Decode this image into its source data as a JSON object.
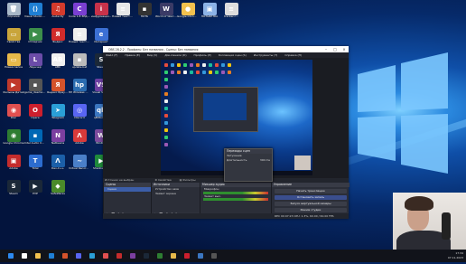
{
  "desktop_icons": [
    {
      "label": "Корзина",
      "color": "#a9b8c8",
      "glyph": "🗑"
    },
    {
      "label": "Visual Studio Code",
      "color": "#1f7fd4",
      "glyph": "⟨⟩"
    },
    {
      "label": "Audacity",
      "color": "#d33a2c",
      "glyph": "♫"
    },
    {
      "label": "Code 1.8 ЗРД код",
      "color": "#7a3fd1",
      "glyph": "C"
    },
    {
      "label": "инфурмацио..",
      "color": "#c8324a",
      "glyph": "i"
    },
    {
      "label": "Новый текстовый...",
      "color": "#e6e6e6",
      "glyph": "≡"
    },
    {
      "label": "ПОТЬ",
      "color": "#333",
      "glyph": "▪"
    },
    {
      "label": "World of Warcraft",
      "color": "#3b3b66",
      "glyph": "W"
    },
    {
      "label": "Google Chrome Beta",
      "color": "#f2c14e",
      "glyph": "●"
    },
    {
      "label": "ПОТЬВЕТКА",
      "color": "#8cb3e6",
      "glyph": "▣"
    },
    {
      "label": "tracker.c...",
      "color": "#ddd",
      "glyph": "≡"
    },
    {
      "label": "Свойства",
      "color": "#c9a53b",
      "glyph": "▭"
    },
    {
      "label": "Отладчик",
      "color": "#3c8e4a",
      "glyph": "▶"
    },
    {
      "label": "Яндекс",
      "color": "#d12b2b",
      "glyph": "Я"
    },
    {
      "label": "Новый текстовый",
      "color": "#eee",
      "glyph": "≡"
    },
    {
      "label": "Интернет",
      "color": "#3b6fd4",
      "glyph": "e"
    },
    {
      "label": "Новая папка",
      "color": "#e8b94a",
      "glyph": "▭"
    },
    {
      "label": "Лаунчер",
      "color": "#6b4ca8",
      "glyph": "L"
    },
    {
      "label": "ABC",
      "color": "#f0f0f0",
      "glyph": "AB"
    },
    {
      "label": "update.bat",
      "color": "#bbb",
      "glyph": "▪"
    },
    {
      "label": "Steam",
      "color": "#1b2838",
      "glyph": "S"
    },
    {
      "label": "Фильмы Детей",
      "color": "#c0392b",
      "glyph": "▶"
    },
    {
      "label": "game_daemon.exe",
      "color": "#555",
      "glyph": "▪"
    },
    {
      "label": "Яндекс Браузер",
      "color": "#d4532b",
      "glyph": "Я"
    },
    {
      "label": "HP Wireless Menu",
      "color": "#2b6cb0",
      "glyph": "hp"
    },
    {
      "label": "Visual Studio",
      "color": "#6b3fa0",
      "glyph": "VS"
    },
    {
      "label": "Disc",
      "color": "#e05050",
      "glyph": "◉"
    },
    {
      "label": "Opera",
      "color": "#cc1f2d",
      "glyph": "O"
    },
    {
      "label": "Telegram",
      "color": "#2a9fd6",
      "glyph": "➤"
    },
    {
      "label": "Discord",
      "color": "#5865f2",
      "glyph": "◎"
    },
    {
      "label": "qBittorrent",
      "color": "#3b76c0",
      "glyph": "qb"
    },
    {
      "label": "Google Chrome",
      "color": "#2e7d32",
      "glyph": "◉"
    },
    {
      "label": "Intel Audio Controller",
      "color": "#0068b5",
      "glyph": "▪"
    },
    {
      "label": "Netbeans",
      "color": "#7b3fa0",
      "glyph": "N"
    },
    {
      "label": "Adobe",
      "color": "#d83a3a",
      "glyph": "Λ"
    },
    {
      "label": "WinRAR",
      "color": "#7b4a9c",
      "glyph": "W"
    },
    {
      "label": "Adobe",
      "color": "#c42c2c",
      "glyph": "▣"
    },
    {
      "label": "Total",
      "color": "#2c6ccf",
      "glyph": "T"
    },
    {
      "label": "Dev-C++",
      "color": "#1b5fa8",
      "glyph": "Λ"
    },
    {
      "label": "Virtual Recorder",
      "color": "#4a7fc8",
      "glyph": "~"
    },
    {
      "label": "ShadowPlay",
      "color": "#1f8a3b",
      "glyph": "▶"
    },
    {
      "label": "Steam",
      "color": "#1b2838",
      "glyph": "S"
    },
    {
      "label": "PVP",
      "color": "#1b2838",
      "glyph": "▶"
    },
    {
      "label": "SafeWares",
      "color": "#4a8a2a",
      "glyph": "◆"
    }
  ],
  "obs": {
    "title": "OBS 28.2.2 - Профиль: Без названия - Сцены: Без названия",
    "menu": [
      "Файл (F)",
      "Правка (E)",
      "Вид (V)",
      "Док-панели (D)",
      "Профиль (P)",
      "Коллекция сцен (S)",
      "Инструменты (T)",
      "Справка (H)"
    ],
    "preview_bar": [
      "Источник не выбран",
      "⚙ Свойства",
      "▤ Фильтры"
    ],
    "scenes_header": "Сцены",
    "scenes": [
      "Сцена"
    ],
    "sources_header": "Источники",
    "sources": [
      "Устройство захв",
      "Захват экрана"
    ],
    "mixer_header": "Микшер аудио",
    "mixer_items": [
      "Микрофон",
      "Захват вых."
    ],
    "transitions_header": "Переходы сцен",
    "controls_header": "Управление",
    "controls": [
      "Начать трансляцию",
      "Остановить запись",
      "Запуск виртуальной камеры",
      "Режим студии",
      "Настройки",
      "Выход"
    ],
    "status": "REC 00:07:23   CPU: 1.3%, 60.00 / 60.00 FPS",
    "popup": [
      {
        "label": "Затухание",
        "value": ""
      },
      {
        "label": "Длительность",
        "value": "300 ms"
      }
    ]
  },
  "taskbar": {
    "time": "17:34",
    "date": "07.11.2023"
  }
}
